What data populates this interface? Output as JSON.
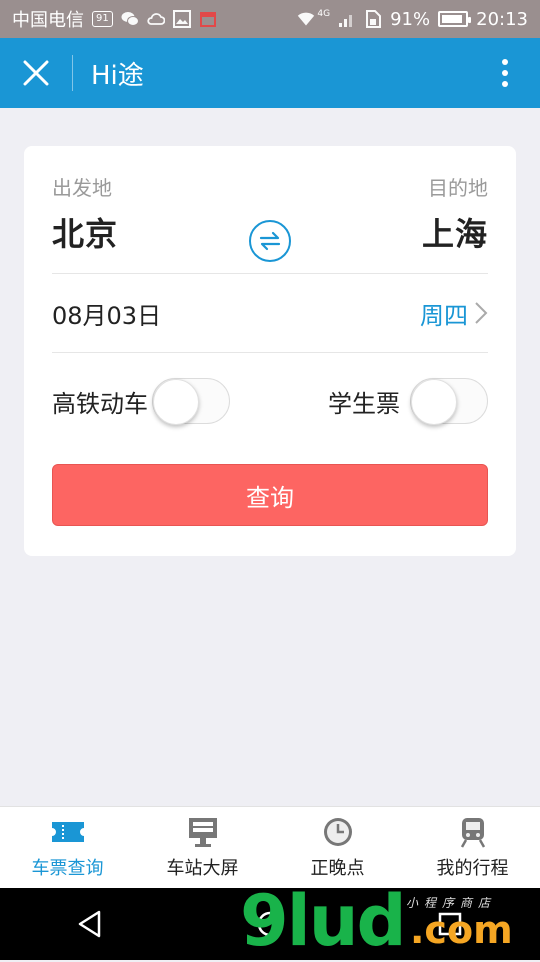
{
  "status_bar": {
    "carrier": "中国电信",
    "sim_badge": "91",
    "network": "4G",
    "battery": "91%",
    "time": "20:13"
  },
  "header": {
    "title": "Hi途",
    "close_icon": "close-icon",
    "more_icon": "more-vertical-icon"
  },
  "form": {
    "from_label": "出发地",
    "from_city": "北京",
    "to_label": "目的地",
    "to_city": "上海",
    "date": "08月03日",
    "weekday": "周四",
    "option_highspeed": "高铁动车",
    "option_highspeed_on": false,
    "option_student": "学生票",
    "option_student_on": false,
    "search_button": "查询"
  },
  "tabs": [
    {
      "label": "车票查询",
      "icon": "ticket-icon",
      "active": true
    },
    {
      "label": "车站大屏",
      "icon": "monitor-icon",
      "active": false
    },
    {
      "label": "正晚点",
      "icon": "clock-icon",
      "active": false
    },
    {
      "label": "我的行程",
      "icon": "train-icon",
      "active": false
    }
  ],
  "watermark": {
    "main": "9lud",
    "suffix": ".com",
    "sub": "小程序商店"
  },
  "colors": {
    "primary": "#1a96d5",
    "accent": "#fd6562",
    "background": "#efeff4"
  }
}
